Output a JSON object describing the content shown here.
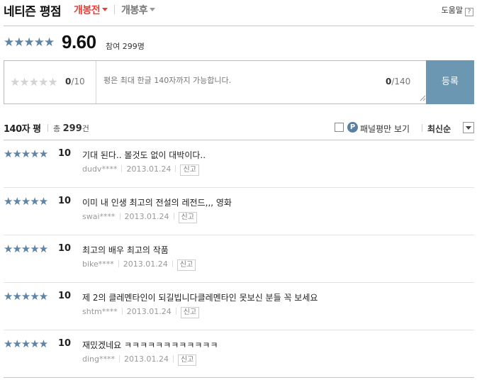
{
  "header": {
    "title": "네티즌 평점",
    "tab_before": "개봉전",
    "tab_after": "개봉후",
    "help": "도움말",
    "help_icon": "?"
  },
  "score": {
    "stars": "★★★★★",
    "value": "9.60",
    "participants": "참여 299명"
  },
  "input": {
    "rating_stars": "★★★★★",
    "rating_value": "0",
    "rating_max": "/10",
    "placeholder": "평은 최대 한글 140자까지 가능합니다.",
    "count_value": "0",
    "count_max": "/140",
    "submit": "등록"
  },
  "list_header": {
    "title": "140자 평",
    "total_prefix": "총",
    "total_count": "299",
    "total_suffix": "건",
    "panel_badge": "P",
    "panel_label": "패널평만 보기",
    "sort_label": "최신순"
  },
  "reviews": [
    {
      "stars": "★★★★★",
      "score": "10",
      "text": "기대 된다.. 볼것도 없이 대박이다..",
      "user": "dudv****",
      "date": "2013.01.24",
      "report": "신고"
    },
    {
      "stars": "★★★★★",
      "score": "10",
      "text": "이미 내 인생 최고의 전설의 레전드,,, 영화",
      "user": "swai****",
      "date": "2013.01.24",
      "report": "신고"
    },
    {
      "stars": "★★★★★",
      "score": "10",
      "text": "최고의 배우 최고의 작품",
      "user": "bike****",
      "date": "2013.01.24",
      "report": "신고"
    },
    {
      "stars": "★★★★★",
      "score": "10",
      "text": "제 2의 클레멘타인이 되길빕니다클레멘타인 못보신 분들 꼭 보세요",
      "user": "shtm****",
      "date": "2013.01.24",
      "report": "신고"
    },
    {
      "stars": "★★★★★",
      "score": "10",
      "text": "재밌겠네요 ㅋㅋㅋㅋㅋㅋㅋㅋㅋㅋㅋㅋ",
      "user": "ding****",
      "date": "2013.01.24",
      "report": "신고"
    }
  ],
  "colors": {
    "accent_red": "#e8413b",
    "star_blue": "#5e84a6",
    "button_blue": "#6b97b3"
  }
}
